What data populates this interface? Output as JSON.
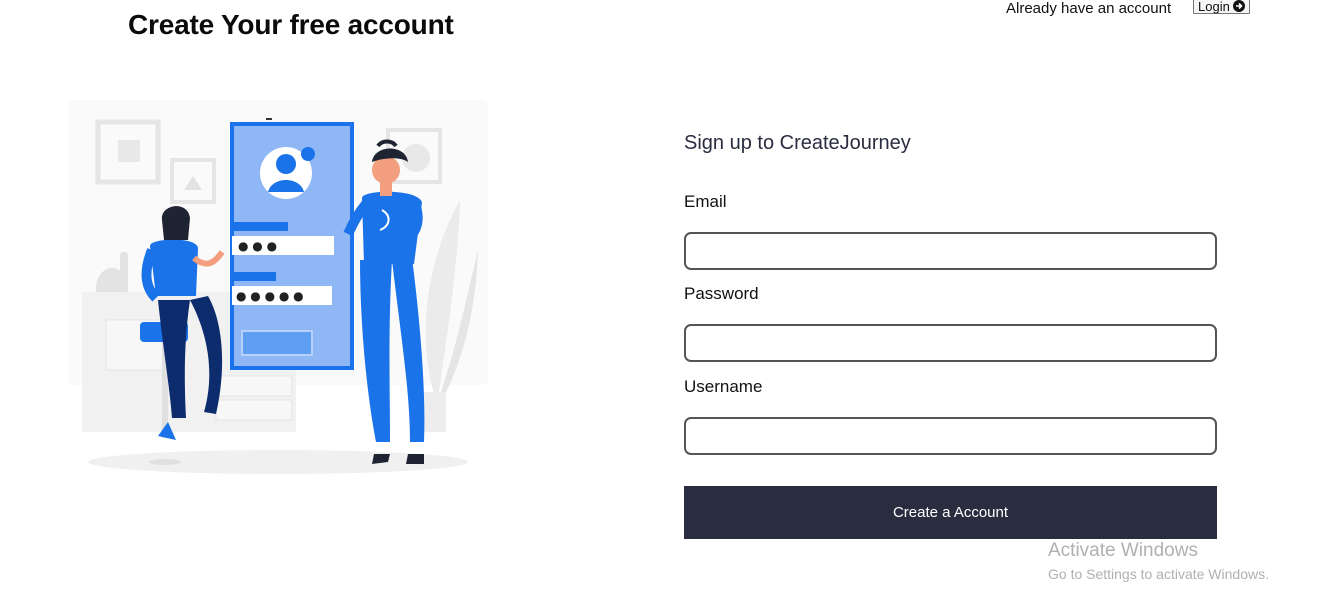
{
  "header": {
    "title": "Create Your free account",
    "already_text": "Already have an account",
    "login_label": "Login"
  },
  "illustration": {
    "icon": "signup-illustration",
    "password_dots_short": "● ● ●",
    "password_dots_long": "● ● ● ● ●"
  },
  "form": {
    "heading": "Sign up to CreateJourney",
    "email_label": "Email",
    "email_value": "",
    "password_label": "Password",
    "password_value": "",
    "username_label": "Username",
    "username_value": "",
    "submit_label": "Create a Account"
  },
  "watermark": {
    "title": "Activate Windows",
    "subtitle": "Go to Settings to activate Windows."
  },
  "colors": {
    "accent_blue": "#1a73e8",
    "button_dark": "#2a2c40",
    "heading": "#2a2c3f"
  }
}
